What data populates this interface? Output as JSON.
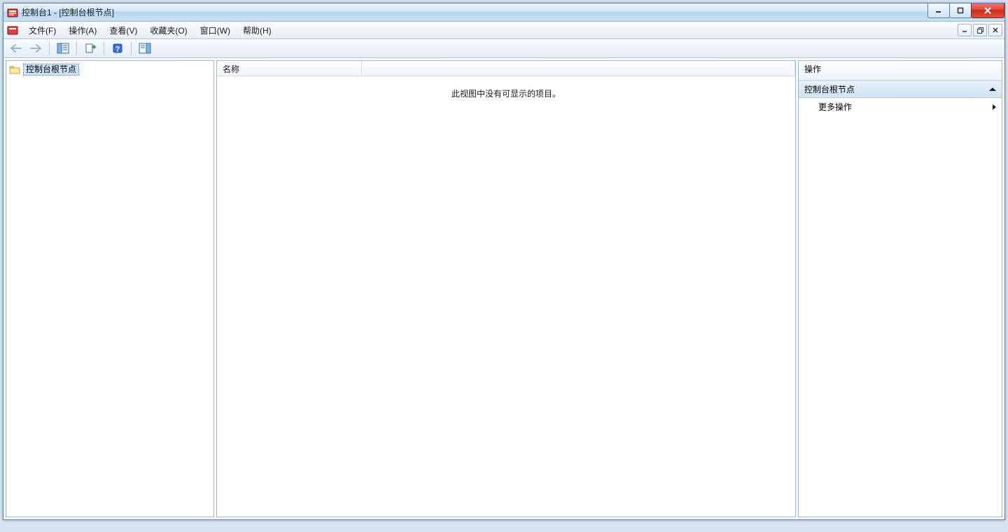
{
  "titlebar": {
    "text": "控制台1 - [控制台根节点]"
  },
  "menu": {
    "file": "文件(F)",
    "action": "操作(A)",
    "view": "查看(V)",
    "fav": "收藏夹(O)",
    "window": "窗口(W)",
    "help": "帮助(H)"
  },
  "tree": {
    "root_label": "控制台根节点"
  },
  "list": {
    "col_name": "名称",
    "empty": "此视图中没有可显示的项目。"
  },
  "actions": {
    "pane_title": "操作",
    "group_title": "控制台根节点",
    "more": "更多操作"
  }
}
